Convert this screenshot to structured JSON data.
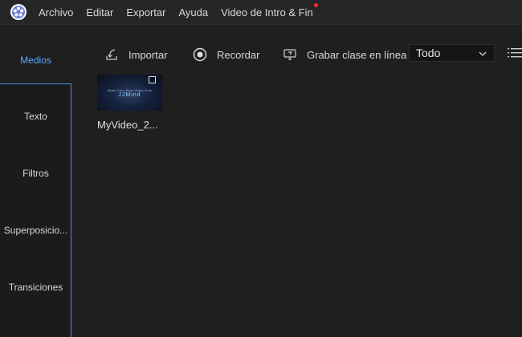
{
  "menubar": {
    "items": [
      "Archivo",
      "Editar",
      "Exportar",
      "Ayuda",
      "Video de Intro & Fin"
    ]
  },
  "sidebar": {
    "items": [
      {
        "label": "Medios",
        "active": true
      },
      {
        "label": "Texto"
      },
      {
        "label": "Filtros"
      },
      {
        "label": "Superposicio..."
      },
      {
        "label": "Transiciones"
      }
    ]
  },
  "toolbar": {
    "import_label": "Importar",
    "record_label": "Recordar",
    "online_label": "Grabar clase en línea",
    "filter_value": "Todo"
  },
  "media": {
    "items": [
      {
        "name": "MyVideo_2...",
        "thumb_small": "Make Your Best Video Now",
        "thumb_big": "JJMind"
      }
    ]
  },
  "colors": {
    "accent": "#4a8fe3",
    "active_text": "#5aa9ff",
    "notification": "#ff2a2a"
  }
}
